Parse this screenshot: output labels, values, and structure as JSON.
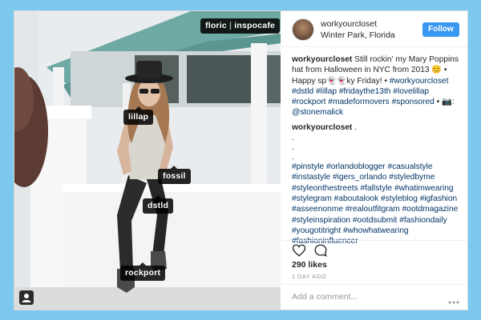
{
  "post": {
    "tags": [
      "floric",
      "inspocafe",
      "lillap",
      "fossil",
      "dstld",
      "rockport"
    ]
  },
  "header": {
    "username": "workyourcloset",
    "location": "Winter Park, Florida",
    "follow_label": "Follow"
  },
  "caption": {
    "username": "workyourcloset",
    "text": "Still rockin' my Mary Poppins hat from Halloween in NYC from 2013 😊 • Happy sp👻👻ky Friday! •",
    "hashtags": "#workyourcloset #dstld #lillap #fridaythe13th #lovelillap #rockport #madeformovers #sponsored",
    "tail": "• 📷:",
    "mention": "@stonemalick"
  },
  "comment2": {
    "username": "workyourcloset",
    "text": ".",
    "dots": [
      ".",
      ".",
      "."
    ],
    "hashtags": "#pinstyle #orlandoblogger #casualstyle #instastyle #igers_orlando #styledbyme #styleonthestreets #fallstyle #whatimwearing #stylegram #aboutalook #styleblog #igfashion #asseenonme #realoutfitgram #ootdmagazine #styleinspiration #ootdsubmit #fashiondaily #yougotitright #whowhatwearing #fashioninfluencer"
  },
  "footer": {
    "likes": "290 likes",
    "time_ago": "1 DAY AGO",
    "add_comment_placeholder": "Add a comment..."
  },
  "icons": {
    "like": "heart-icon",
    "comment": "comment-icon",
    "tagged_people": "person-icon",
    "more": "more-options-icon"
  },
  "colors": {
    "background": "#7cc8ee",
    "follow_button": "#3897f0",
    "link": "#003569"
  }
}
